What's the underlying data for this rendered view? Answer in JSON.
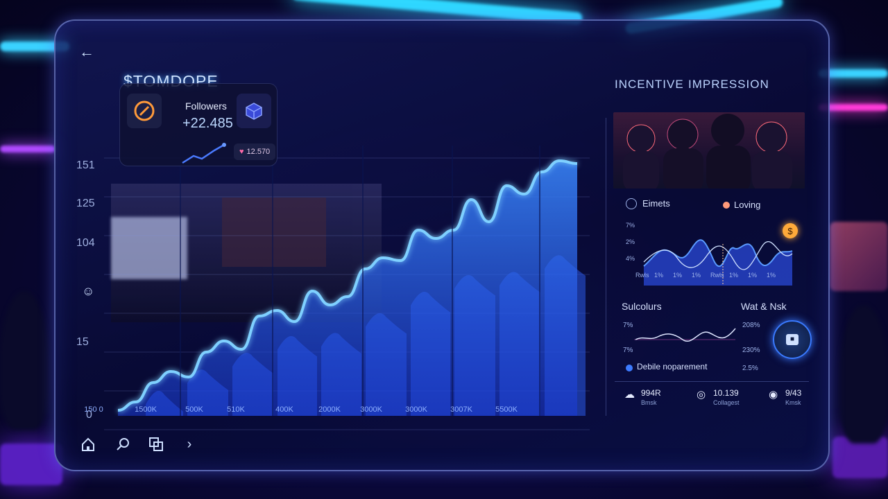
{
  "app": {
    "title": "$TOMDOPE"
  },
  "stats_card": {
    "followers_label": "Followers",
    "followers_value": "+22.485",
    "likes_value": "12.570"
  },
  "main_chart": {
    "y_ticks": [
      "151",
      "125",
      "104",
      "15",
      "0"
    ],
    "x_ticks": [
      "150 0",
      "1500K",
      "500K",
      "510K",
      "400K",
      "2000K",
      "3000K",
      "3000K",
      "3007K",
      "5500K"
    ],
    "series": [
      {
        "name": "",
        "values": [
          2,
          5,
          12,
          16,
          14,
          23,
          27,
          24,
          36,
          38,
          34,
          45,
          40,
          43,
          53,
          57,
          56,
          67,
          64,
          67,
          78,
          70,
          83,
          80,
          88,
          92,
          91
        ]
      }
    ]
  },
  "right_panel": {
    "tabs": [
      "INCENTIVE",
      "IMPRESSION"
    ],
    "legend": [
      {
        "label": "Eimets",
        "color": "#3d7bff"
      },
      {
        "label": "Loving",
        "color": "#ff9a7a"
      }
    ],
    "mini_chart": {
      "y_ticks": [
        "7%",
        "2%",
        "4%"
      ],
      "x_ticks": [
        "Rwls",
        "1%",
        "1%",
        "1%",
        "Rwls",
        "1%",
        "1%",
        "1%"
      ]
    },
    "subs": {
      "title": "Sulcolurs",
      "y_ticks": [
        "7%",
        "7%"
      ],
      "legend_label": "Debile noparement"
    },
    "watch": {
      "title": "Wat & Nsk",
      "values": [
        "208%",
        "230%",
        "2.5%"
      ]
    },
    "footer_stats": [
      {
        "icon": "cloud-icon",
        "value": "994R",
        "sub": "Bmsk"
      },
      {
        "icon": "location-icon",
        "value": "10.139",
        "sub": "Collagest"
      },
      {
        "icon": "pin-icon",
        "value": "9/43",
        "sub": "Kmsk"
      }
    ]
  },
  "nav": {
    "items": [
      "home-icon",
      "search-icon",
      "copy-icon",
      "chevron-right-icon"
    ]
  }
}
